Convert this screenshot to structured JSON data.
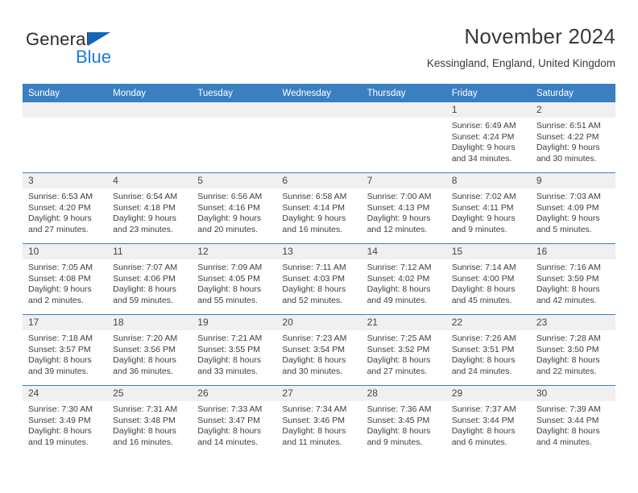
{
  "brand": {
    "name_top": "General",
    "name_bottom": "Blue",
    "accent_color": "#1a7ad4",
    "triangle_color": "#1565b6"
  },
  "header": {
    "month_title": "November 2024",
    "location": "Kessingland, England, United Kingdom"
  },
  "theme": {
    "header_bg": "#3a7fc1",
    "daynum_bg": "#f0f0f0",
    "text_color": "#3d3d3d"
  },
  "weekday_headers": [
    "Sunday",
    "Monday",
    "Tuesday",
    "Wednesday",
    "Thursday",
    "Friday",
    "Saturday"
  ],
  "weeks": [
    [
      {
        "day": "",
        "lines": []
      },
      {
        "day": "",
        "lines": []
      },
      {
        "day": "",
        "lines": []
      },
      {
        "day": "",
        "lines": []
      },
      {
        "day": "",
        "lines": []
      },
      {
        "day": "1",
        "lines": [
          "Sunrise: 6:49 AM",
          "Sunset: 4:24 PM",
          "Daylight: 9 hours",
          "and 34 minutes."
        ]
      },
      {
        "day": "2",
        "lines": [
          "Sunrise: 6:51 AM",
          "Sunset: 4:22 PM",
          "Daylight: 9 hours",
          "and 30 minutes."
        ]
      }
    ],
    [
      {
        "day": "3",
        "lines": [
          "Sunrise: 6:53 AM",
          "Sunset: 4:20 PM",
          "Daylight: 9 hours",
          "and 27 minutes."
        ]
      },
      {
        "day": "4",
        "lines": [
          "Sunrise: 6:54 AM",
          "Sunset: 4:18 PM",
          "Daylight: 9 hours",
          "and 23 minutes."
        ]
      },
      {
        "day": "5",
        "lines": [
          "Sunrise: 6:56 AM",
          "Sunset: 4:16 PM",
          "Daylight: 9 hours",
          "and 20 minutes."
        ]
      },
      {
        "day": "6",
        "lines": [
          "Sunrise: 6:58 AM",
          "Sunset: 4:14 PM",
          "Daylight: 9 hours",
          "and 16 minutes."
        ]
      },
      {
        "day": "7",
        "lines": [
          "Sunrise: 7:00 AM",
          "Sunset: 4:13 PM",
          "Daylight: 9 hours",
          "and 12 minutes."
        ]
      },
      {
        "day": "8",
        "lines": [
          "Sunrise: 7:02 AM",
          "Sunset: 4:11 PM",
          "Daylight: 9 hours",
          "and 9 minutes."
        ]
      },
      {
        "day": "9",
        "lines": [
          "Sunrise: 7:03 AM",
          "Sunset: 4:09 PM",
          "Daylight: 9 hours",
          "and 5 minutes."
        ]
      }
    ],
    [
      {
        "day": "10",
        "lines": [
          "Sunrise: 7:05 AM",
          "Sunset: 4:08 PM",
          "Daylight: 9 hours",
          "and 2 minutes."
        ]
      },
      {
        "day": "11",
        "lines": [
          "Sunrise: 7:07 AM",
          "Sunset: 4:06 PM",
          "Daylight: 8 hours",
          "and 59 minutes."
        ]
      },
      {
        "day": "12",
        "lines": [
          "Sunrise: 7:09 AM",
          "Sunset: 4:05 PM",
          "Daylight: 8 hours",
          "and 55 minutes."
        ]
      },
      {
        "day": "13",
        "lines": [
          "Sunrise: 7:11 AM",
          "Sunset: 4:03 PM",
          "Daylight: 8 hours",
          "and 52 minutes."
        ]
      },
      {
        "day": "14",
        "lines": [
          "Sunrise: 7:12 AM",
          "Sunset: 4:02 PM",
          "Daylight: 8 hours",
          "and 49 minutes."
        ]
      },
      {
        "day": "15",
        "lines": [
          "Sunrise: 7:14 AM",
          "Sunset: 4:00 PM",
          "Daylight: 8 hours",
          "and 45 minutes."
        ]
      },
      {
        "day": "16",
        "lines": [
          "Sunrise: 7:16 AM",
          "Sunset: 3:59 PM",
          "Daylight: 8 hours",
          "and 42 minutes."
        ]
      }
    ],
    [
      {
        "day": "17",
        "lines": [
          "Sunrise: 7:18 AM",
          "Sunset: 3:57 PM",
          "Daylight: 8 hours",
          "and 39 minutes."
        ]
      },
      {
        "day": "18",
        "lines": [
          "Sunrise: 7:20 AM",
          "Sunset: 3:56 PM",
          "Daylight: 8 hours",
          "and 36 minutes."
        ]
      },
      {
        "day": "19",
        "lines": [
          "Sunrise: 7:21 AM",
          "Sunset: 3:55 PM",
          "Daylight: 8 hours",
          "and 33 minutes."
        ]
      },
      {
        "day": "20",
        "lines": [
          "Sunrise: 7:23 AM",
          "Sunset: 3:54 PM",
          "Daylight: 8 hours",
          "and 30 minutes."
        ]
      },
      {
        "day": "21",
        "lines": [
          "Sunrise: 7:25 AM",
          "Sunset: 3:52 PM",
          "Daylight: 8 hours",
          "and 27 minutes."
        ]
      },
      {
        "day": "22",
        "lines": [
          "Sunrise: 7:26 AM",
          "Sunset: 3:51 PM",
          "Daylight: 8 hours",
          "and 24 minutes."
        ]
      },
      {
        "day": "23",
        "lines": [
          "Sunrise: 7:28 AM",
          "Sunset: 3:50 PM",
          "Daylight: 8 hours",
          "and 22 minutes."
        ]
      }
    ],
    [
      {
        "day": "24",
        "lines": [
          "Sunrise: 7:30 AM",
          "Sunset: 3:49 PM",
          "Daylight: 8 hours",
          "and 19 minutes."
        ]
      },
      {
        "day": "25",
        "lines": [
          "Sunrise: 7:31 AM",
          "Sunset: 3:48 PM",
          "Daylight: 8 hours",
          "and 16 minutes."
        ]
      },
      {
        "day": "26",
        "lines": [
          "Sunrise: 7:33 AM",
          "Sunset: 3:47 PM",
          "Daylight: 8 hours",
          "and 14 minutes."
        ]
      },
      {
        "day": "27",
        "lines": [
          "Sunrise: 7:34 AM",
          "Sunset: 3:46 PM",
          "Daylight: 8 hours",
          "and 11 minutes."
        ]
      },
      {
        "day": "28",
        "lines": [
          "Sunrise: 7:36 AM",
          "Sunset: 3:45 PM",
          "Daylight: 8 hours",
          "and 9 minutes."
        ]
      },
      {
        "day": "29",
        "lines": [
          "Sunrise: 7:37 AM",
          "Sunset: 3:44 PM",
          "Daylight: 8 hours",
          "and 6 minutes."
        ]
      },
      {
        "day": "30",
        "lines": [
          "Sunrise: 7:39 AM",
          "Sunset: 3:44 PM",
          "Daylight: 8 hours",
          "and 4 minutes."
        ]
      }
    ]
  ]
}
